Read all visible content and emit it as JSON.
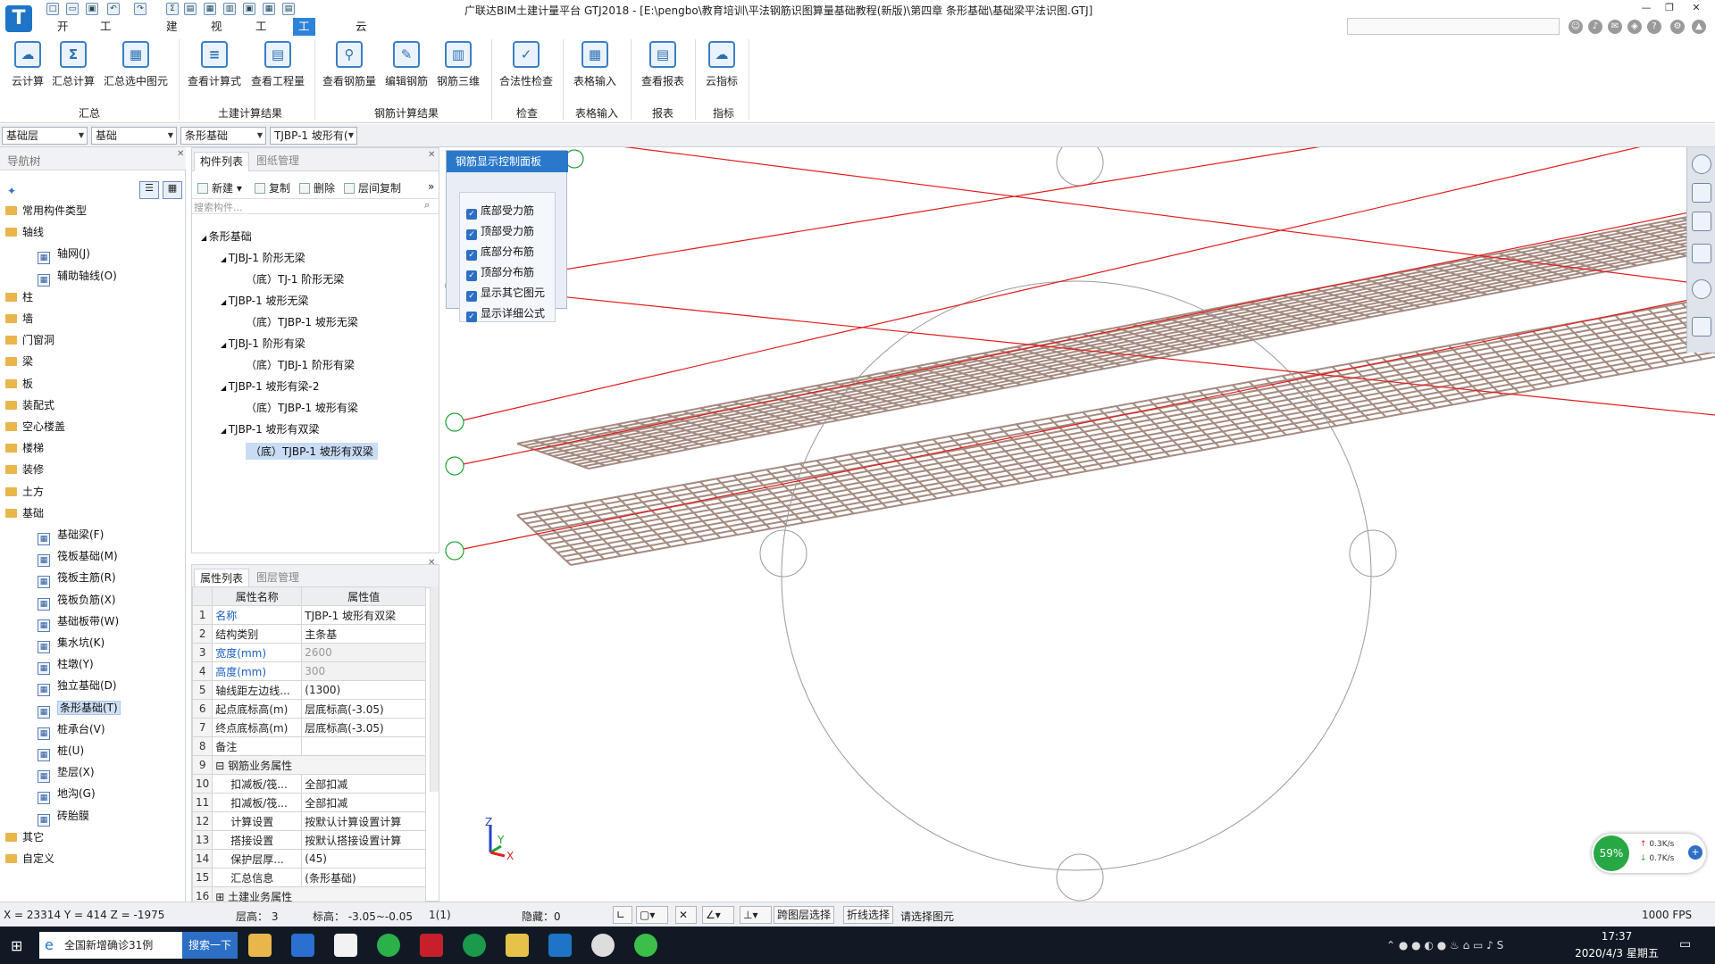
{
  "title": "广联达BIM土建计量平台 GTJ2018 - [E:\\pengbo\\教育培训\\平法钢筋识图算量基础教程(新版)\\第四章 条形基础\\基础梁平法识图.GTJ]",
  "app_logo": "T",
  "menu_tabs": [
    "开始",
    "工程设置",
    "建模",
    "视图",
    "工具",
    "工程量",
    "云应用"
  ],
  "search_placeholder": "",
  "ribbon": {
    "buttons": [
      {
        "label": "云计算",
        "icon": "cloud-calc-icon",
        "glyph": "☁"
      },
      {
        "label": "汇总计算",
        "icon": "sum-icon",
        "glyph": "Σ"
      },
      {
        "label": "汇总选中图元",
        "icon": "sum-selected-icon",
        "glyph": "▦"
      },
      {
        "label": "查看计算式",
        "icon": "view-formula-icon",
        "glyph": "≡"
      },
      {
        "label": "查看工程量",
        "icon": "view-quantity-icon",
        "glyph": "▤"
      },
      {
        "label": "查看钢筋量",
        "icon": "view-rebar-qty-icon",
        "glyph": "⚲"
      },
      {
        "label": "编辑钢筋",
        "icon": "edit-rebar-icon",
        "glyph": "✎"
      },
      {
        "label": "钢筋三维",
        "icon": "rebar-3d-icon",
        "glyph": "▥"
      },
      {
        "label": "合法性检查",
        "icon": "check-icon",
        "glyph": "✓"
      },
      {
        "label": "表格输入",
        "icon": "table-input-icon",
        "glyph": "▦"
      },
      {
        "label": "查看报表",
        "icon": "report-icon",
        "glyph": "▤"
      },
      {
        "label": "云指标",
        "icon": "cloud-index-icon",
        "glyph": "☁"
      }
    ],
    "groups": [
      "汇总",
      "土建计算结果",
      "钢筋计算结果",
      "检查",
      "表格输入",
      "报表",
      "指标"
    ]
  },
  "selectors": [
    "基础层",
    "基础",
    "条形基础",
    "TJBP-1 坡形有("
  ],
  "nav": {
    "title": "导航树",
    "items": [
      {
        "label": "常用构件类型",
        "level": 0
      },
      {
        "label": "轴线",
        "level": 0
      },
      {
        "label": "轴网(J)",
        "level": 1
      },
      {
        "label": "辅助轴线(O)",
        "level": 1
      },
      {
        "label": "柱",
        "level": 0
      },
      {
        "label": "墙",
        "level": 0
      },
      {
        "label": "门窗洞",
        "level": 0
      },
      {
        "label": "梁",
        "level": 0
      },
      {
        "label": "板",
        "level": 0
      },
      {
        "label": "装配式",
        "level": 0
      },
      {
        "label": "空心楼盖",
        "level": 0
      },
      {
        "label": "楼梯",
        "level": 0
      },
      {
        "label": "装修",
        "level": 0
      },
      {
        "label": "土方",
        "level": 0
      },
      {
        "label": "基础",
        "level": 0
      },
      {
        "label": "基础梁(F)",
        "level": 1
      },
      {
        "label": "筏板基础(M)",
        "level": 1
      },
      {
        "label": "筏板主筋(R)",
        "level": 1
      },
      {
        "label": "筏板负筋(X)",
        "level": 1
      },
      {
        "label": "基础板带(W)",
        "level": 1
      },
      {
        "label": "集水坑(K)",
        "level": 1
      },
      {
        "label": "柱墩(Y)",
        "level": 1
      },
      {
        "label": "独立基础(D)",
        "level": 1
      },
      {
        "label": "条形基础(T)",
        "level": 1,
        "selected": true
      },
      {
        "label": "桩承台(V)",
        "level": 1
      },
      {
        "label": "桩(U)",
        "level": 1
      },
      {
        "label": "垫层(X)",
        "level": 1
      },
      {
        "label": "地沟(G)",
        "level": 1
      },
      {
        "label": "砖胎膜",
        "level": 1
      },
      {
        "label": "其它",
        "level": 0
      },
      {
        "label": "自定义",
        "level": 0
      }
    ]
  },
  "component_panel": {
    "tabs": [
      "构件列表",
      "图纸管理"
    ],
    "toolbar": [
      "新建",
      "复制",
      "删除",
      "层间复制"
    ],
    "search_placeholder": "搜索构件...",
    "tree": [
      {
        "label": "条形基础",
        "level": 0
      },
      {
        "label": "TJBJ-1 阶形无梁",
        "level": 1
      },
      {
        "label": "（底）TJ-1 阶形无梁",
        "level": 2
      },
      {
        "label": "TJBP-1 坡形无梁",
        "level": 1
      },
      {
        "label": "（底）TJBP-1 坡形无梁",
        "level": 2
      },
      {
        "label": "TJBJ-1 阶形有梁",
        "level": 1
      },
      {
        "label": "（底）TJBJ-1 阶形有梁",
        "level": 2
      },
      {
        "label": "TJBP-1 坡形有梁-2",
        "level": 1
      },
      {
        "label": "（底）TJBP-1 坡形有梁",
        "level": 2
      },
      {
        "label": "TJBP-1 坡形有双梁",
        "level": 1
      },
      {
        "label": "（底）TJBP-1 坡形有双梁",
        "level": 2,
        "selected": true
      }
    ]
  },
  "properties": {
    "tabs": [
      "属性列表",
      "图层管理"
    ],
    "headers": [
      "属性名称",
      "属性值"
    ],
    "rows": [
      {
        "n": "1",
        "k": "名称",
        "v": "TJBP-1 坡形有双梁",
        "style": "blue"
      },
      {
        "n": "2",
        "k": "结构类别",
        "v": "主条基",
        "style": ""
      },
      {
        "n": "3",
        "k": "宽度(mm)",
        "v": "2600",
        "style": "blue-gray"
      },
      {
        "n": "4",
        "k": "高度(mm)",
        "v": "300",
        "style": "blue-gray"
      },
      {
        "n": "5",
        "k": "轴线距左边线...",
        "v": "(1300)",
        "style": ""
      },
      {
        "n": "6",
        "k": "起点底标高(m)",
        "v": "层底标高(-3.05)",
        "style": ""
      },
      {
        "n": "7",
        "k": "终点底标高(m)",
        "v": "层底标高(-3.05)",
        "style": ""
      },
      {
        "n": "8",
        "k": "备注",
        "v": "",
        "style": ""
      },
      {
        "n": "9",
        "k": "⊟ 钢筋业务属性",
        "v": "",
        "style": "group"
      },
      {
        "n": "10",
        "k": "扣减板/筏...",
        "v": "全部扣减",
        "style": "indent"
      },
      {
        "n": "11",
        "k": "扣减板/筏...",
        "v": "全部扣减",
        "style": "indent"
      },
      {
        "n": "12",
        "k": "计算设置",
        "v": "按默认计算设置计算",
        "style": "indent"
      },
      {
        "n": "13",
        "k": "搭接设置",
        "v": "按默认搭接设置计算",
        "style": "indent"
      },
      {
        "n": "14",
        "k": "保护层厚...",
        "v": "(45)",
        "style": "indent"
      },
      {
        "n": "15",
        "k": "汇总信息",
        "v": "(条形基础)",
        "style": "indent"
      },
      {
        "n": "16",
        "k": "⊞ 土建业务属性",
        "v": "",
        "style": "group"
      }
    ]
  },
  "rebar_panel": {
    "title": "钢筋显示控制面板",
    "options": [
      "底部受力筋",
      "顶部受力筋",
      "底部分布筋",
      "顶部分布筋",
      "显示其它图元",
      "显示详细公式"
    ]
  },
  "axis_labels": {
    "z": "Z",
    "y": "Y",
    "x": "X"
  },
  "speed_widget": {
    "percent": "59%",
    "up": "0.3K/s",
    "down": "0.7K/s"
  },
  "status": {
    "coords": "X = 23314 Y = 414 Z = -1975",
    "floor_height": "层高： 3",
    "elevation": "标高： -3.05~-0.05",
    "count": "1(1)",
    "hidden": "隐藏：0",
    "btn_cross": "跨图层选择",
    "btn_polyline": "折线选择",
    "hint": "请选择图元",
    "fps": "1000 FPS"
  },
  "taskbar": {
    "browser_tab": "全国新增确诊31例",
    "search_btn": "搜索一下",
    "time": "17:37",
    "date": "2020/4/3 星期五"
  },
  "colors": {
    "accent": "#2d83d8",
    "rebar": "#a89088",
    "axis_line": "#e21b1b",
    "axis_circle": "#1ea32e"
  }
}
